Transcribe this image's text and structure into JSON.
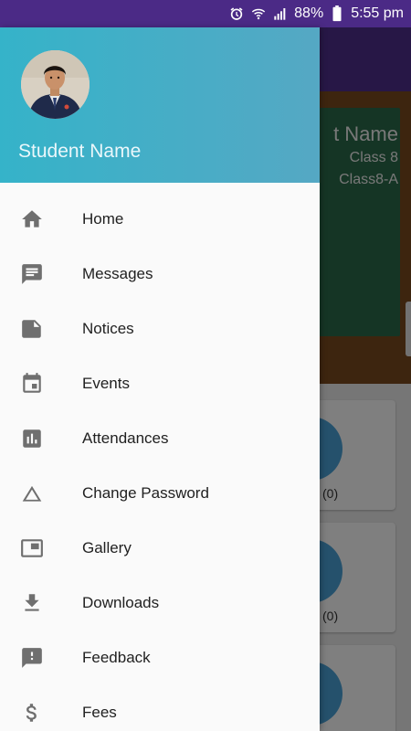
{
  "status_bar": {
    "battery": "88%",
    "time": "5:55 pm",
    "icons": [
      "alarm-icon",
      "wifi-icon",
      "signal-icon",
      "battery-icon"
    ]
  },
  "background": {
    "board_name": "t Name",
    "board_class": "Class 8",
    "board_section": "Class8-A",
    "cards": [
      {
        "count": "(0)"
      },
      {
        "count": "(0)"
      },
      {
        "count": ""
      }
    ]
  },
  "drawer": {
    "header_name": "Student Name",
    "colors": {
      "header_start": "#35b3c9",
      "header_end": "#55a8c4",
      "icon": "#6f6f6f"
    },
    "items": [
      {
        "label": "Home",
        "icon": "home-icon"
      },
      {
        "label": "Messages",
        "icon": "message-icon"
      },
      {
        "label": "Notices",
        "icon": "notice-icon"
      },
      {
        "label": "Events",
        "icon": "calendar-icon"
      },
      {
        "label": "Attendances",
        "icon": "bar-chart-icon"
      },
      {
        "label": "Change Password",
        "icon": "triangle-icon"
      },
      {
        "label": "Gallery",
        "icon": "gallery-icon"
      },
      {
        "label": "Downloads",
        "icon": "download-icon"
      },
      {
        "label": "Feedback",
        "icon": "feedback-icon"
      },
      {
        "label": "Fees",
        "icon": "dollar-icon"
      }
    ]
  }
}
